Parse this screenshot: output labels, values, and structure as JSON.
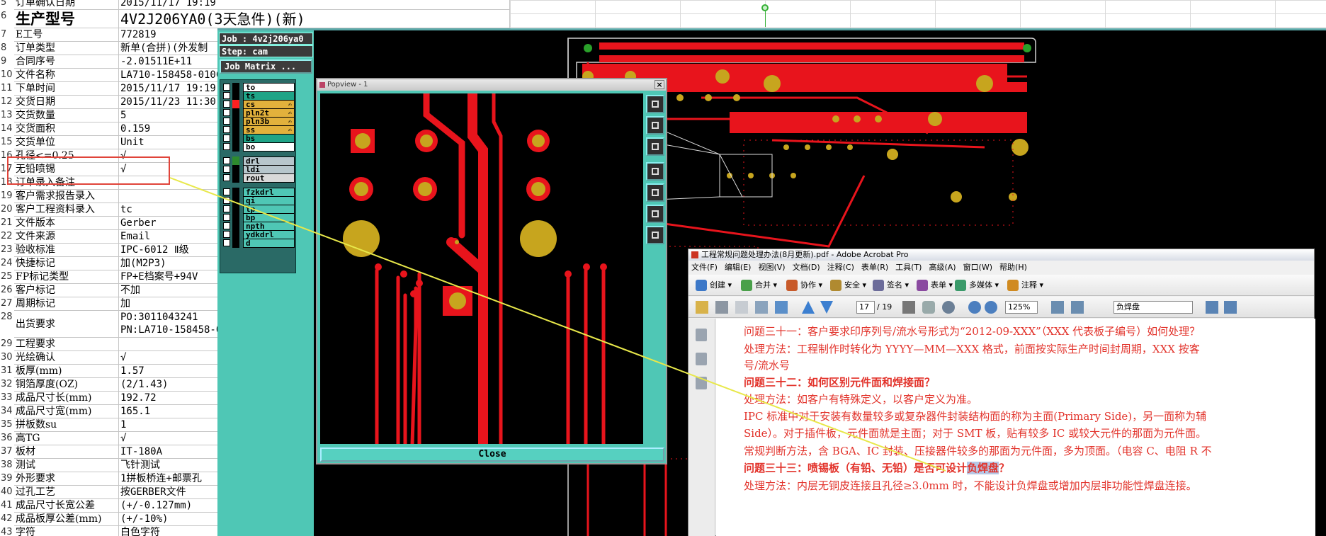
{
  "sheet": {
    "rows": [
      {
        "num": "5",
        "label": "订单确认日期",
        "value": "2015/11/17 19:19"
      },
      {
        "num": "6",
        "label": "生产型号",
        "value": "4V2J206YA0(3天急件)(新)"
      },
      {
        "num": "7",
        "label": "E工号",
        "value": "772819"
      },
      {
        "num": "8",
        "label": "订单类型",
        "value": "新单(合拼)(外发制"
      },
      {
        "num": "9",
        "label": "合同序号",
        "value": "-2.01511E+11"
      },
      {
        "num": "10",
        "label": "文件名称",
        "value": "LA710-158458-010C"
      },
      {
        "num": "11",
        "label": "下单时间",
        "value": "2015/11/17 19:19"
      },
      {
        "num": "12",
        "label": "交货日期",
        "value": "2015/11/23 11:30"
      },
      {
        "num": "13",
        "label": "交货数量",
        "value": "5"
      },
      {
        "num": "14",
        "label": "交货面积",
        "value": "0.159"
      },
      {
        "num": "15",
        "label": "交货单位",
        "value": "Unit"
      },
      {
        "num": "16",
        "label": "孔径<=0.25",
        "value": "√"
      },
      {
        "num": "17",
        "label": "无铅喷锡",
        "value": "√"
      },
      {
        "num": "18",
        "label": "订单录入备注",
        "value": ""
      },
      {
        "num": "19",
        "label": "客户需求报告录入",
        "value": ""
      },
      {
        "num": "20",
        "label": "客户工程资料录入",
        "value": "tc"
      },
      {
        "num": "21",
        "label": "文件版本",
        "value": "Gerber"
      },
      {
        "num": "22",
        "label": "文件来源",
        "value": "Email"
      },
      {
        "num": "23",
        "label": "验收标准",
        "value": "IPC-6012 Ⅱ级"
      },
      {
        "num": "24",
        "label": "快捷标记",
        "value": "加(M2P3)"
      },
      {
        "num": "25",
        "label": "FP标记类型",
        "value": "FP+E档案号+94V"
      },
      {
        "num": "26",
        "label": "客户标记",
        "value": "不加"
      },
      {
        "num": "27",
        "label": "周期标记",
        "value": "加"
      },
      {
        "num": "28",
        "label": "出货要求",
        "value": "PO:3011043241",
        "value2": "PN:LA710-158458-0"
      },
      {
        "num": "29",
        "label": "工程要求",
        "value": ""
      },
      {
        "num": "30",
        "label": "光绘确认",
        "value": "√"
      },
      {
        "num": "31",
        "label": "板厚(mm)",
        "value": "1.57"
      },
      {
        "num": "32",
        "label": "铜箔厚度(OZ)",
        "value": "(2/1.43)"
      },
      {
        "num": "33",
        "label": "成品尺寸长(mm)",
        "value": "192.72"
      },
      {
        "num": "34",
        "label": "成品尺寸宽(mm)",
        "value": "165.1"
      },
      {
        "num": "35",
        "label": "拼板数su",
        "value": "1"
      },
      {
        "num": "36",
        "label": "高TG",
        "value": "√"
      },
      {
        "num": "37",
        "label": "板材",
        "value": "IT-180A"
      },
      {
        "num": "38",
        "label": "测试",
        "value": "飞针测试"
      },
      {
        "num": "39",
        "label": "外形要求",
        "value": "1拼板桥连+邮票孔"
      },
      {
        "num": "40",
        "label": "过孔工艺",
        "value": "按GERBER文件"
      },
      {
        "num": "41",
        "label": "成品尺寸长宽公差",
        "value": "(+/-0.127mm)"
      },
      {
        "num": "42",
        "label": "成品板厚公差(mm)",
        "value": "(+/-10%)"
      },
      {
        "num": "43",
        "label": "字符",
        "value": "白色字符"
      }
    ]
  },
  "cam": {
    "job": "Job : 4v2j206ya0",
    "step": "Step: cam",
    "job_matrix": "Job Matrix ...",
    "layers": [
      {
        "name": "to",
        "color": "#ffffff",
        "swatch": "#000000",
        "flag": ""
      },
      {
        "name": "ts",
        "color": "#1fa487",
        "swatch": "#000000",
        "flag": ""
      },
      {
        "name": "cs",
        "color": "#e2b13c",
        "swatch": "#ff2020",
        "flag": "✍"
      },
      {
        "name": "pln2t",
        "color": "#e2b13c",
        "swatch": "#000000",
        "flag": "✍"
      },
      {
        "name": "pln3b",
        "color": "#e2b13c",
        "swatch": "#000000",
        "flag": "✍"
      },
      {
        "name": "ss",
        "color": "#e2b13c",
        "swatch": "#000000",
        "flag": "✍"
      },
      {
        "name": "bs",
        "color": "#1fa487",
        "swatch": "#000000",
        "flag": ""
      },
      {
        "name": "bo",
        "color": "#ffffff",
        "swatch": "#000000",
        "flag": ""
      },
      {
        "name": "drl",
        "color": "#b7c6cc",
        "swatch": "#2e8b2e",
        "flag": ""
      },
      {
        "name": "ldi",
        "color": "#b7c6cc",
        "swatch": "#000000",
        "flag": ""
      },
      {
        "name": "rout",
        "color": "#d9d9d9",
        "swatch": "#000000",
        "flag": ""
      },
      {
        "name": "fzkdrl",
        "color": "#4fc7b5",
        "swatch": "#000000",
        "flag": ""
      },
      {
        "name": "qi",
        "color": "#4fc7b5",
        "swatch": "#000000",
        "flag": ""
      },
      {
        "name": "tp",
        "color": "#4fc7b5",
        "swatch": "#000000",
        "flag": ""
      },
      {
        "name": "bp",
        "color": "#4fc7b5",
        "swatch": "#000000",
        "flag": ""
      },
      {
        "name": "npth",
        "color": "#4fc7b5",
        "swatch": "#000000",
        "flag": ""
      },
      {
        "name": "ydkdrl",
        "color": "#4fc7b5",
        "swatch": "#000000",
        "flag": ""
      },
      {
        "name": "d",
        "color": "#4fc7b5",
        "swatch": "#000000",
        "flag": ""
      }
    ],
    "popview": {
      "title": "Popview - 1",
      "close_x": "×",
      "close_label": "Close"
    }
  },
  "acrobat": {
    "title": "工程常规问题处理办法(8月更新).pdf - Adobe Acrobat Pro",
    "menu": [
      "文件(F)",
      "编辑(E)",
      "视图(V)",
      "文档(D)",
      "注释(C)",
      "表单(R)",
      "工具(T)",
      "高级(A)",
      "窗口(W)",
      "帮助(H)"
    ],
    "toolbar1": [
      "创建 ▾",
      "合并 ▾",
      "协作 ▾",
      "安全 ▾",
      "签名 ▾",
      "表单 ▾",
      "多媒体 ▾",
      "注释 ▾"
    ],
    "page_num": "17",
    "page_total": "/ 19",
    "zoom": "125%",
    "search": "负焊盘",
    "lines": [
      {
        "text": "问题三十一：客户要求印序列号/流水号形式为“2012-09-XXX”（XXX 代表板子编号）如何处理？",
        "bold": false
      },
      {
        "text": "处理方法：工程制作时转化为 YYYY—MM—XXX 格式，前面按实际生产时间封周期，XXX 按客",
        "bold": false
      },
      {
        "text": "号/流水号",
        "bold": false
      },
      {
        "text": "问题三十二：如何区别元件面和焊接面？",
        "bold": true
      },
      {
        "text": "处理方法：如客户有特殊定义，以客户定义为准。",
        "bold": false
      },
      {
        "text": "IPC 标准中对于安装有数量较多或复杂器件封装结构面的称为主面(Primary Side)，另一面称为辅",
        "bold": false
      },
      {
        "text": "Side）。对于插件板，元件面就是主面；对于 SMT 板，贴有较多 IC 或较大元件的那面为元件面。",
        "bold": false
      },
      {
        "text": "常规判断方法，含 BGA、IC 封装、压接器件较多的那面为元件面，多为顶面。（电容 C、电阻 R 不",
        "bold": false
      },
      {
        "text": "问题三十三：喷锡板（有铅、无铅）是否可设计负焊盘？",
        "bold": true,
        "highlight": "负焊盘"
      },
      {
        "text": "处理方法：内层无铜皮连接且孔径≥3.0mm 时，不能设计负焊盘或增加内层非功能性焊盘连接。",
        "bold": false
      }
    ]
  }
}
